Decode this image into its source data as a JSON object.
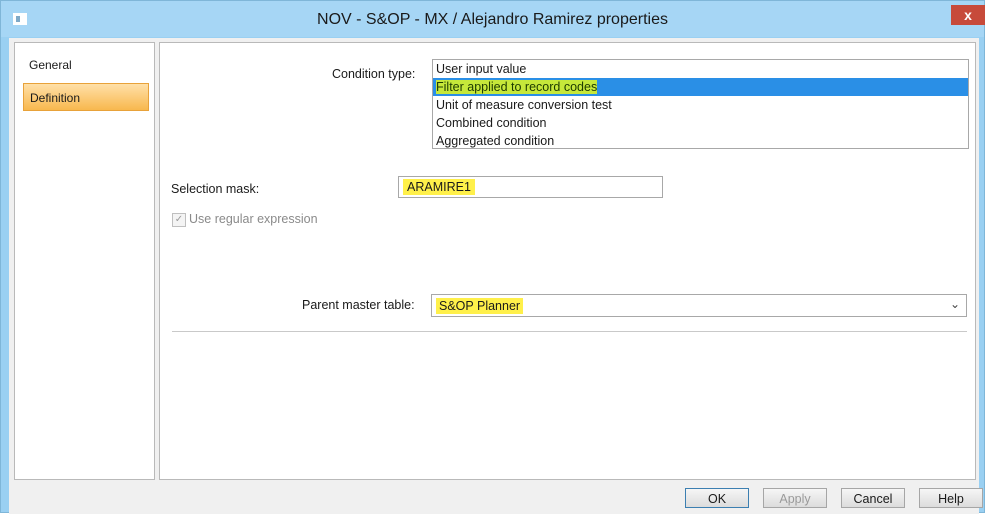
{
  "window": {
    "title": "NOV - S&OP - MX / Alejandro Ramirez properties",
    "close_label": "x"
  },
  "nav": {
    "items": [
      {
        "label": "General"
      },
      {
        "label": "Definition",
        "selected": true
      }
    ]
  },
  "definition": {
    "condition_type_label": "Condition type:",
    "condition_options": [
      "User input value",
      "Filter applied to record codes",
      "Unit of measure conversion test",
      "Combined condition",
      "Aggregated condition"
    ],
    "selected_condition": "Filter applied to record codes",
    "selection_mask_label": "Selection mask:",
    "selection_mask_value": "ARAMIRE1",
    "use_regex_label": "Use regular expression",
    "use_regex_checked": true,
    "parent_master_table_label": "Parent master table:",
    "parent_master_table_value": "S&OP Planner"
  },
  "buttons": {
    "ok": "OK",
    "apply": "Apply",
    "cancel": "Cancel",
    "help": "Help"
  },
  "colors": {
    "titlebar": "#a6d6f5",
    "selection": "#2a8fe6",
    "highlight_yellow": "#fff04a",
    "nav_selected": "#f8b84e"
  }
}
